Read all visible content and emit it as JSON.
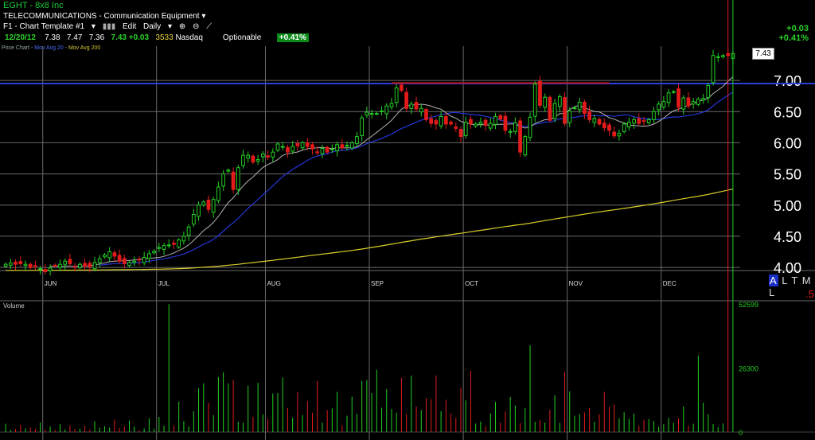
{
  "header": {
    "symbol": "EGHT - 8x8 Inc",
    "industry": "TELECOMMUNICATIONS - Communication Equipment",
    "toolbar": {
      "template": "F1 - Chart Template #1",
      "edit": "Edit",
      "period": "Daily"
    },
    "quote": {
      "date": "12/20/12",
      "open": "7.38",
      "high": "7.47",
      "low": "7.36",
      "last": "7.43",
      "change": "+0.03",
      "volume": "3533",
      "exchange": "Nasdaq",
      "optionable": "Optionable",
      "pct": "+0.41%"
    },
    "change_right": "+0.03",
    "pct_right": "+0.41%",
    "legend": {
      "price": "Price Chart",
      "ma20": "Mov Avg 20",
      "ma200": "Mov Avg 200"
    },
    "altml": "ALTML",
    "marker": ".5",
    "last_price_label": "7.43",
    "volume_label": "Volume"
  },
  "colors": {
    "up": "#22d022",
    "down": "#e21b1b",
    "ma_short": "#b3b3b3",
    "ma_mid": "#2436d8",
    "ma_long": "#d8cf2a",
    "grid": "#6a6a6a",
    "hline_blue": "#2a3ee0",
    "hline_red": "#b01818"
  },
  "chart_data": {
    "type": "candlestick",
    "x_tick_labels": [
      "JUN",
      "JUL",
      "AUG",
      "SEP",
      "OCT",
      "NOV",
      "DEC"
    ],
    "y_tick_labels": [
      "7.00",
      "6.50",
      "6.00",
      "5.50",
      "5.00",
      "4.50",
      "4.00"
    ],
    "ylim": [
      3.95,
      7.55
    ],
    "volume_tick_labels": [
      "52599",
      "26300",
      "0"
    ],
    "volume_ylim": [
      0,
      52599
    ],
    "month_start_index": [
      8,
      31,
      53,
      74,
      93,
      114,
      133
    ],
    "horizontal_lines": [
      {
        "price": 6.95,
        "color": "blue",
        "from_index": 0,
        "to_index": 147
      },
      {
        "price": 6.96,
        "color": "red",
        "from_index": 78,
        "to_index": 122
      }
    ],
    "close": [
      4.05,
      4.07,
      4.05,
      4.06,
      4.05,
      4.0,
      4.02,
      3.98,
      3.93,
      3.99,
      4.03,
      4.05,
      4.1,
      4.06,
      4.01,
      4.05,
      4.02,
      4.01,
      4.08,
      4.14,
      4.2,
      4.25,
      4.18,
      4.1,
      4.06,
      4.08,
      4.1,
      4.12,
      4.16,
      4.22,
      4.26,
      4.32,
      4.35,
      4.36,
      4.37,
      4.44,
      4.5,
      4.65,
      4.85,
      5.0,
      5.05,
      4.93,
      5.09,
      5.29,
      5.5,
      5.56,
      5.25,
      5.6,
      5.8,
      5.8,
      5.69,
      5.73,
      5.82,
      5.77,
      5.85,
      5.98,
      5.94,
      5.85,
      5.94,
      5.95,
      6.0,
      5.94,
      5.9,
      5.84,
      5.91,
      5.85,
      5.9,
      5.97,
      5.92,
      5.96,
      6.0,
      6.1,
      6.4,
      6.49,
      6.47,
      6.47,
      6.51,
      6.59,
      6.63,
      6.88,
      6.84,
      6.55,
      6.62,
      6.54,
      6.55,
      6.37,
      6.31,
      6.3,
      6.42,
      6.3,
      6.3,
      6.23,
      6.1,
      6.33,
      6.3,
      6.3,
      6.33,
      6.28,
      6.31,
      6.42,
      6.38,
      6.2,
      6.18,
      6.32,
      5.85,
      6.1,
      6.41,
      6.94,
      6.6,
      6.73,
      6.36,
      6.63,
      6.74,
      6.31,
      6.51,
      6.56,
      6.65,
      6.47,
      6.37,
      6.39,
      6.3,
      6.24,
      6.2,
      6.11,
      6.15,
      6.3,
      6.33,
      6.37,
      6.31,
      6.35,
      6.37,
      6.5,
      6.62,
      6.66,
      6.8,
      6.82,
      6.57,
      6.72,
      6.59,
      6.66,
      6.7,
      6.71,
      6.92,
      7.4,
      7.38,
      7.4,
      7.4,
      7.43
    ],
    "volume": [
      3400,
      900,
      1300,
      2900,
      1500,
      1900,
      1200,
      3900,
      1000,
      2300,
      800,
      3200,
      1100,
      2700,
      1300,
      1400,
      2600,
      1000,
      4400,
      1800,
      2400,
      1800,
      5100,
      1600,
      2300,
      4700,
      2300,
      700,
      1500,
      5700,
      1400,
      6200,
      2600,
      52500,
      2700,
      12500,
      4500,
      2300,
      8600,
      18000,
      20000,
      12000,
      7000,
      22600,
      24500,
      20000,
      21300,
      4300,
      3800,
      19000,
      6300,
      20200,
      7300,
      5400,
      15800,
      16000,
      22400,
      9800,
      5900,
      16300,
      7000,
      12700,
      7900,
      21000,
      3900,
      9000,
      9700,
      16500,
      2800,
      6700,
      14500,
      7500,
      21000,
      21300,
      16000,
      25600,
      10000,
      17600,
      9500,
      7900,
      22300,
      7400,
      23200,
      10500,
      9000,
      14000,
      13500,
      23200,
      8600,
      13300,
      7700,
      5800,
      18200,
      13000,
      25200,
      3500,
      4300,
      2400,
      7700,
      12400,
      3800,
      8400,
      14400,
      10900,
      3700,
      9800,
      35600,
      4200,
      4900,
      3900,
      9200,
      15100,
      3700,
      24800,
      16700,
      6700,
      7300,
      8000,
      9800,
      4200,
      7300,
      16500,
      10400,
      11300,
      5700,
      8100,
      5500,
      7600,
      2500,
      5000,
      5300,
      4500,
      2200,
      3200,
      5900,
      3700,
      5600,
      10500,
      2600,
      3400,
      31400,
      12000,
      7300,
      3300,
      2000,
      3533
    ]
  }
}
